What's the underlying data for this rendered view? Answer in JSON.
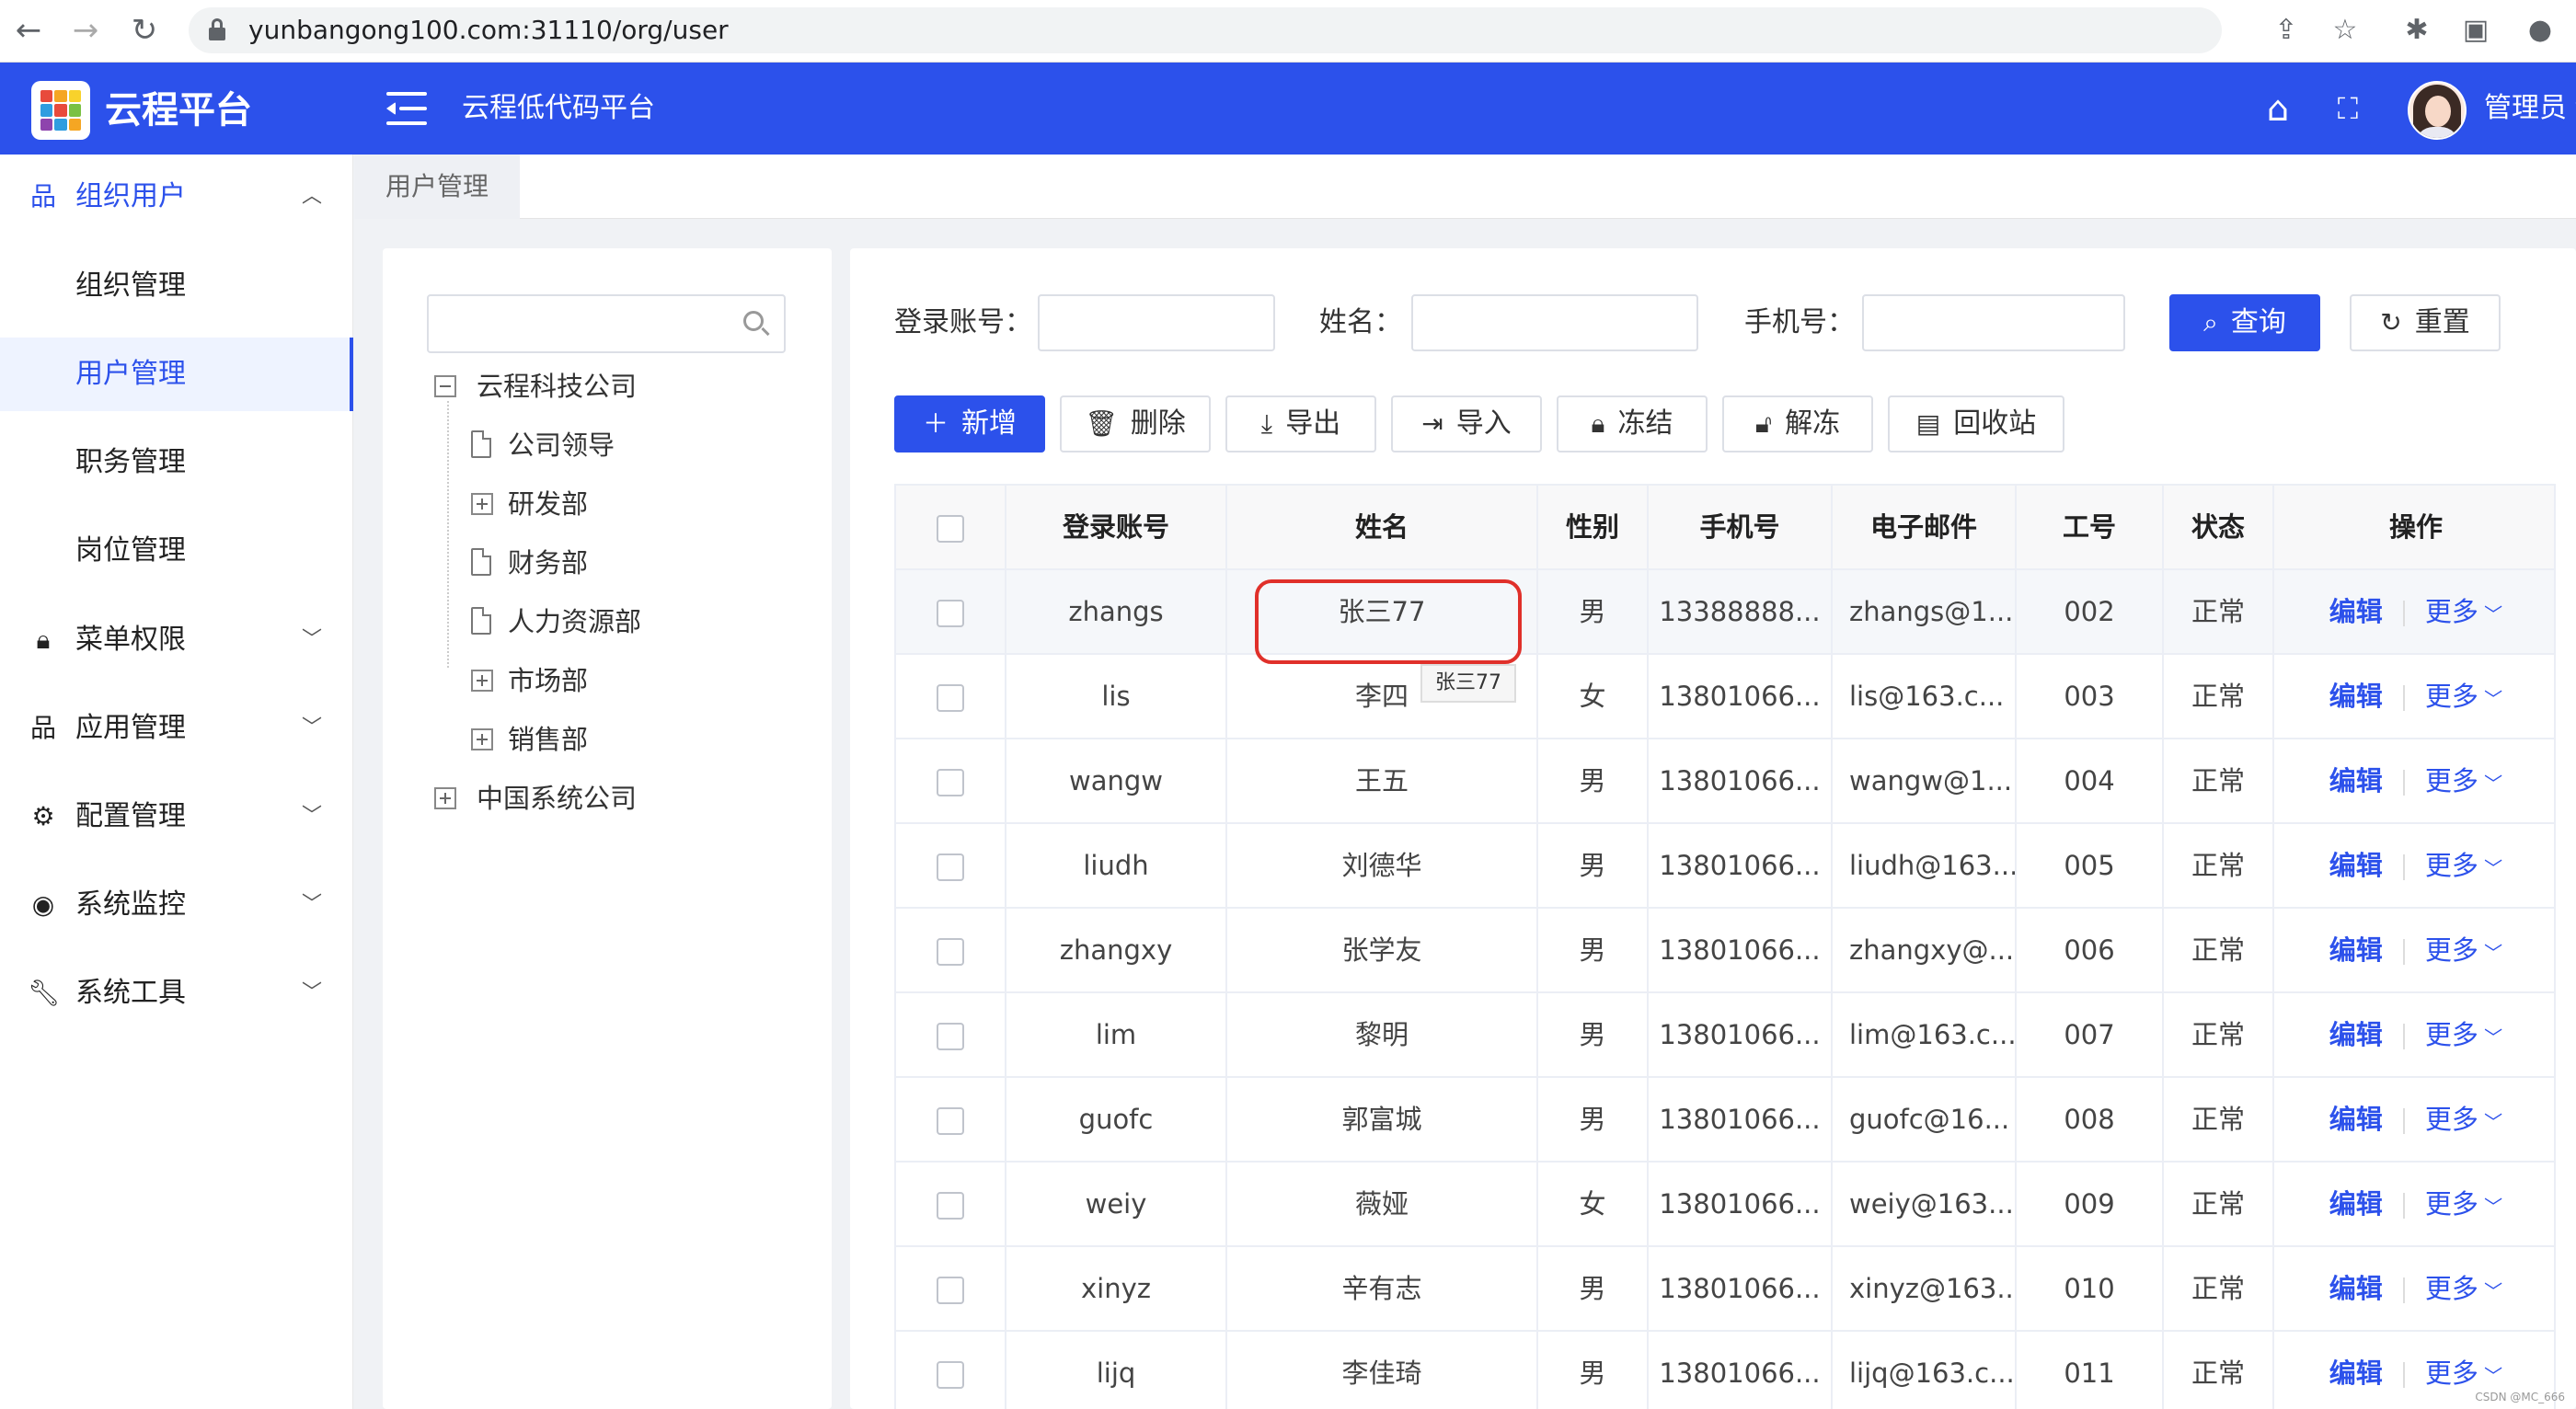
{
  "browser": {
    "url": "yunbangong100.com:31110/org/user"
  },
  "header": {
    "app_title": "云程平台",
    "platform_name": "云程低代码平台",
    "user_name": "管理员"
  },
  "sidebar": {
    "groups": [
      {
        "label": "组织用户",
        "icon": "org-icon",
        "expanded": true,
        "children": [
          "组织管理",
          "用户管理",
          "职务管理",
          "岗位管理"
        ]
      },
      {
        "label": "菜单权限",
        "icon": "lock-icon"
      },
      {
        "label": "应用管理",
        "icon": "app-icon"
      },
      {
        "label": "配置管理",
        "icon": "gear-icon"
      },
      {
        "label": "系统监控",
        "icon": "eye-icon"
      },
      {
        "label": "系统工具",
        "icon": "wrench-icon"
      }
    ],
    "active_item": "用户管理"
  },
  "tabs": [
    {
      "label": "用户管理"
    }
  ],
  "tree": {
    "root": "云程科技公司",
    "children": [
      "公司领导",
      "研发部",
      "财务部",
      "人力资源部",
      "市场部",
      "销售部"
    ],
    "root2": "中国系统公司"
  },
  "search_form": {
    "account_label": "登录账号：",
    "name_label": "姓名：",
    "phone_label": "手机号：",
    "query_button": "查询",
    "reset_button": "重置"
  },
  "toolbar": {
    "add": "新增",
    "delete": "删除",
    "export": "导出",
    "import": "导入",
    "freeze": "冻结",
    "unfreeze": "解冻",
    "recycle": "回收站"
  },
  "table": {
    "headers": [
      "登录账号",
      "姓名",
      "性别",
      "手机号",
      "电子邮件",
      "工号",
      "状态",
      "操作"
    ],
    "rows": [
      {
        "account": "zhangs",
        "name": "张三77",
        "gender": "男",
        "phone": "13388888...",
        "email": "zhangs@1...",
        "no": "002",
        "status": "正常"
      },
      {
        "account": "lis",
        "name": "李四",
        "gender": "女",
        "phone": "13801066...",
        "email": "lis@163.c...",
        "no": "003",
        "status": "正常"
      },
      {
        "account": "wangw",
        "name": "王五",
        "gender": "男",
        "phone": "13801066...",
        "email": "wangw@1...",
        "no": "004",
        "status": "正常"
      },
      {
        "account": "liudh",
        "name": "刘德华",
        "gender": "男",
        "phone": "13801066...",
        "email": "liudh@163...",
        "no": "005",
        "status": "正常"
      },
      {
        "account": "zhangxy",
        "name": "张学友",
        "gender": "男",
        "phone": "13801066...",
        "email": "zhangxy@...",
        "no": "006",
        "status": "正常"
      },
      {
        "account": "lim",
        "name": "黎明",
        "gender": "男",
        "phone": "13801066...",
        "email": "lim@163.c...",
        "no": "007",
        "status": "正常"
      },
      {
        "account": "guofc",
        "name": "郭富城",
        "gender": "男",
        "phone": "13801066...",
        "email": "guofc@16...",
        "no": "008",
        "status": "正常"
      },
      {
        "account": "weiy",
        "name": "薇娅",
        "gender": "女",
        "phone": "13801066...",
        "email": "weiy@163....",
        "no": "009",
        "status": "正常"
      },
      {
        "account": "xinyz",
        "name": "辛有志",
        "gender": "男",
        "phone": "13801066...",
        "email": "xinyz@163...",
        "no": "010",
        "status": "正常"
      },
      {
        "account": "lijq",
        "name": "李佳琦",
        "gender": "男",
        "phone": "13801066...",
        "email": "lijq@163.c...",
        "no": "011",
        "status": "正常"
      }
    ],
    "edit_label": "编辑",
    "more_label": "更多"
  },
  "tooltip": "张三77",
  "watermark": "CSDN @MC_666",
  "colors": {
    "brand": "#2c51eb",
    "highlight": "#e0302a"
  }
}
